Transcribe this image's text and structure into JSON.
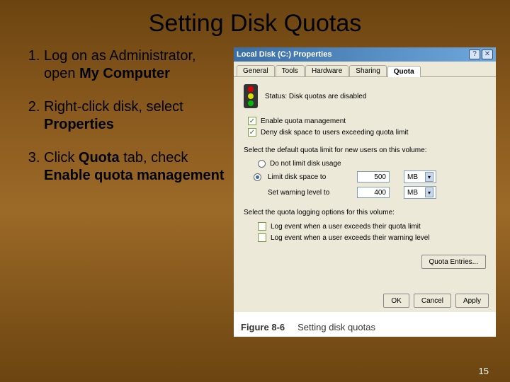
{
  "title": "Setting Disk Quotas",
  "steps": [
    {
      "pre": "Log on as Administrator, open ",
      "bold": "My Computer",
      "post": ""
    },
    {
      "pre": "Right-click disk, select ",
      "bold": "Properties",
      "post": ""
    },
    {
      "pre": "Click ",
      "bold": "Quota",
      "post_pre": " tab, check ",
      "bold2": "Enable quota management",
      "post": ""
    }
  ],
  "dialog": {
    "title": "Local Disk (C:) Properties",
    "help_btn": "?",
    "close_btn": "✕",
    "tabs": [
      "General",
      "Tools",
      "Hardware",
      "Sharing",
      "Quota"
    ],
    "active_tab": "Quota",
    "status_label": "Status:",
    "status_value": "Disk quotas are disabled",
    "enable_quota": "Enable quota management",
    "deny_space": "Deny disk space to users exceeding quota limit",
    "default_limit_label": "Select the default quota limit for new users on this volume:",
    "no_limit": "Do not limit disk usage",
    "limit_to": "Limit disk space to",
    "limit_value": "500",
    "limit_unit": "MB",
    "warn_label": "Set warning level to",
    "warn_value": "400",
    "warn_unit": "MB",
    "logging_label": "Select the quota logging options for this volume:",
    "log_exceed_quota": "Log event when a user exceeds their quota limit",
    "log_exceed_warning": "Log event when a user exceeds their warning level",
    "quota_entries_btn": "Quota Entries...",
    "ok_btn": "OK",
    "cancel_btn": "Cancel",
    "apply_btn": "Apply"
  },
  "figure": {
    "number": "Figure 8-6",
    "caption": "Setting disk quotas"
  },
  "slide_number": "15"
}
